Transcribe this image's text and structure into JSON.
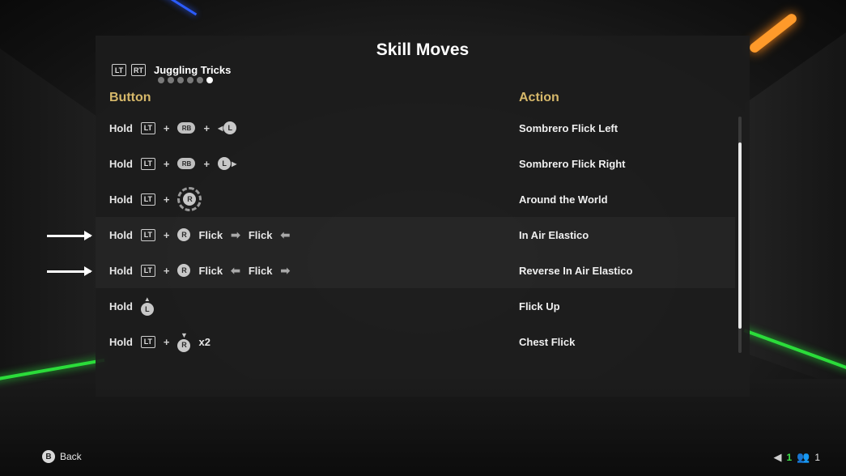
{
  "title": "Skill Moves",
  "category": {
    "triggers": [
      "LT",
      "RT"
    ],
    "label": "Juggling Tricks",
    "page_dots": 6,
    "active_dot": 6
  },
  "columns": {
    "button": "Button",
    "action": "Action"
  },
  "rows": [
    {
      "hold": "Hold",
      "action": "Sombrero Flick Left"
    },
    {
      "hold": "Hold",
      "action": "Sombrero Flick Right"
    },
    {
      "hold": "Hold",
      "action": "Around the World"
    },
    {
      "hold": "Hold",
      "flick1": "Flick",
      "flick2": "Flick",
      "action": "In Air Elastico"
    },
    {
      "hold": "Hold",
      "flick1": "Flick",
      "flick2": "Flick",
      "action": "Reverse In Air Elastico"
    },
    {
      "hold": "Hold",
      "action": "Flick Up"
    },
    {
      "hold": "Hold",
      "times": "x2",
      "action": "Chest Flick"
    }
  ],
  "buttons": {
    "lt": "LT",
    "rb": "RB",
    "l": "L",
    "r": "R"
  },
  "footer": {
    "back_key": "B",
    "back_label": "Back",
    "controller_count": "1",
    "user_count": "1"
  },
  "colors": {
    "accent": "#d6b86a",
    "green": "#3ee04a"
  }
}
